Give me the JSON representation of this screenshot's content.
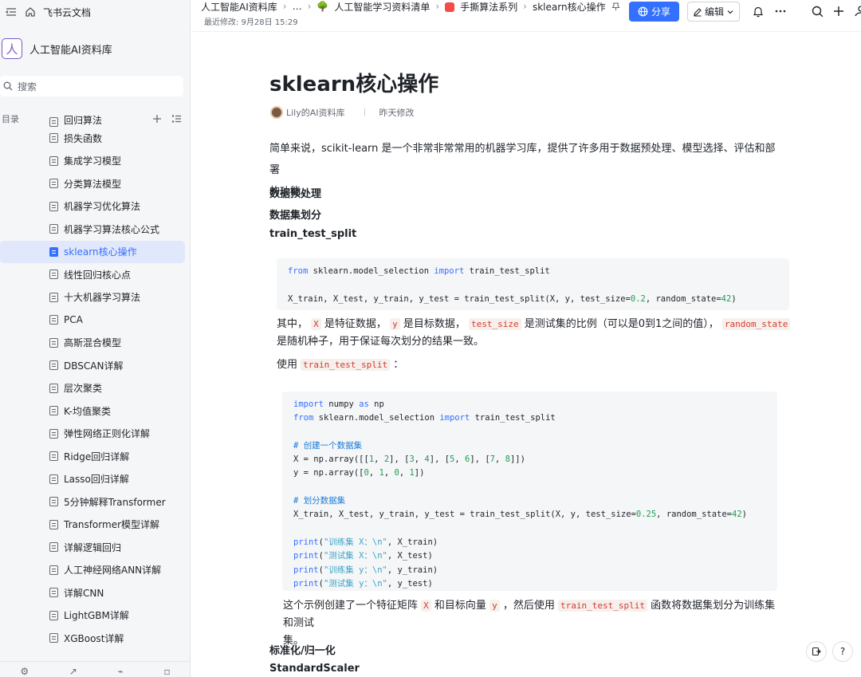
{
  "sidebar": {
    "app_name": "飞书云文档",
    "space_name": "人工智能AI资料库",
    "space_logo": "人",
    "search_placeholder": "搜索",
    "toc_label": "目录",
    "items": [
      {
        "label": "回归算法"
      },
      {
        "label": "损失函数"
      },
      {
        "label": "集成学习模型"
      },
      {
        "label": "分类算法模型"
      },
      {
        "label": "机器学习优化算法"
      },
      {
        "label": "机器学习算法核心公式"
      },
      {
        "label": "sklearn核心操作",
        "active": true
      },
      {
        "label": "线性回归核心点"
      },
      {
        "label": "十大机器学习算法"
      },
      {
        "label": "PCA"
      },
      {
        "label": "高斯混合模型"
      },
      {
        "label": "DBSCAN详解"
      },
      {
        "label": "层次聚类"
      },
      {
        "label": "K-均值聚类"
      },
      {
        "label": "弹性网络正则化详解"
      },
      {
        "label": "Ridge回归详解"
      },
      {
        "label": "Lasso回归详解"
      },
      {
        "label": "5分钟解释Transformer"
      },
      {
        "label": "Transformer模型详解"
      },
      {
        "label": "详解逻辑回归"
      },
      {
        "label": "人工神经网络ANN详解"
      },
      {
        "label": "详解CNN"
      },
      {
        "label": "LightGBM详解"
      },
      {
        "label": "XGBoost详解"
      }
    ]
  },
  "header": {
    "breadcrumbs": [
      "人工智能AI资料库",
      "…",
      "人工智能学习资料清单",
      "手撕算法系列",
      "sklearn核心操作"
    ],
    "last_modified": "最近修改: 9月28日 15:29",
    "share_label": "分享",
    "edit_label": "编辑"
  },
  "doc": {
    "title": "sklearn核心操作",
    "author": "Lily的AI资料库",
    "modified": "昨天修改",
    "intro_line1": "简单来说，scikit-learn 是一个非常非常常用的机器学习库，提供了许多用于数据预处理、模型选择、评估和部署",
    "intro_line2": "的功能。",
    "h_preprocess": "数据预处理",
    "h_split": "数据集划分",
    "h_tts": "train_test_split",
    "explain1": {
      "pre": "其中，",
      "X": "X",
      "t1": "是特征数据，",
      "y": "y",
      "t2": "是目标数据，",
      "test_size": "test_size",
      "t3": "是测试集的比例（可以是0到1之间的值），",
      "random_state": "random_state",
      "line2": "是随机种子，用于保证每次划分的结果一致。"
    },
    "use": {
      "pre": "使用",
      "code": "train_test_split",
      "post": "："
    },
    "explain2": {
      "pre": "这个示例创建了一个特征矩阵",
      "X": "X",
      "t1": "和目标向量",
      "y": "y",
      "t2": "，然后使用",
      "code": "train_test_split",
      "t3": "函数将数据集划分为训练集和测试",
      "line2": "集。"
    },
    "h_norm": "标准化/归一化",
    "h_scaler": "StandardScaler"
  },
  "colors": {
    "accent": "#3370ff",
    "active_bg": "#e1e8fb"
  }
}
